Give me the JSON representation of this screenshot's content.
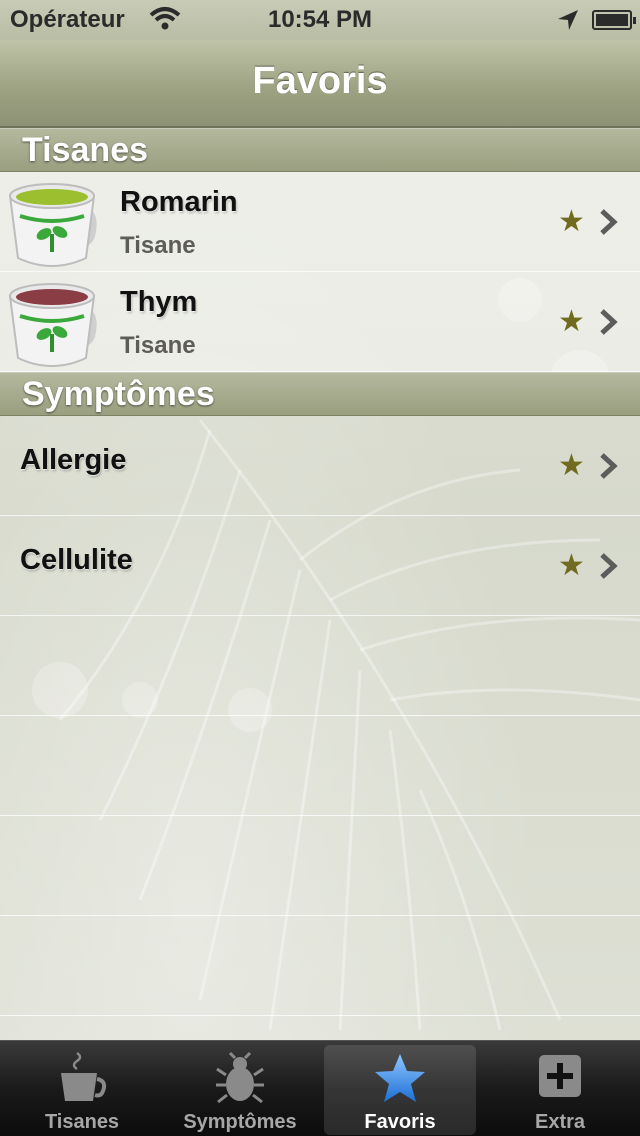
{
  "status_bar": {
    "carrier": "Opérateur",
    "time": "10:54 PM"
  },
  "nav": {
    "title": "Favoris"
  },
  "sections": [
    {
      "header": "Tisanes",
      "items": [
        {
          "title": "Romarin",
          "subtitle": "Tisane",
          "cup_color": "#9bbf2e",
          "icon": "tea-cup-icon"
        },
        {
          "title": "Thym",
          "subtitle": "Tisane",
          "cup_color": "#8a3d44",
          "icon": "tea-cup-icon"
        }
      ]
    },
    {
      "header": "Symptômes",
      "items": [
        {
          "title": "Allergie"
        },
        {
          "title": "Cellulite"
        }
      ]
    }
  ],
  "tab_bar": {
    "tabs": [
      {
        "label": "Tisanes",
        "icon": "tea-cup-icon",
        "selected": false
      },
      {
        "label": "Symptômes",
        "icon": "bug-icon",
        "selected": false
      },
      {
        "label": "Favoris",
        "icon": "star-icon",
        "selected": true
      },
      {
        "label": "Extra",
        "icon": "plus-icon",
        "selected": false
      }
    ]
  },
  "colors": {
    "nav": "#9ea384",
    "star": "#716b1f",
    "tab_selected_icon": "#3f8de8"
  }
}
